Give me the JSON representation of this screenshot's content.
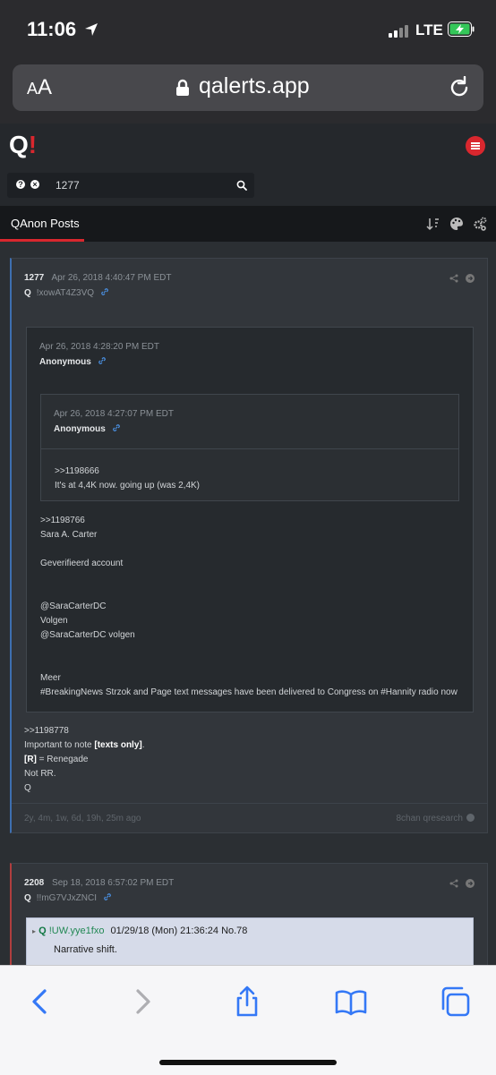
{
  "status": {
    "time": "11:06",
    "network": "LTE"
  },
  "browser": {
    "text_size_label_small": "A",
    "text_size_label_large": "A",
    "domain": "qalerts.app"
  },
  "site": {
    "logo_q": "Q",
    "logo_bang": "!",
    "search": {
      "help": "?",
      "clear": "×",
      "query": "1277"
    },
    "nav_title": "QAnon Posts"
  },
  "posts": [
    {
      "number": "1277",
      "datetime": "Apr 26, 2018 4:40:47 PM EDT",
      "author": "Q",
      "tripcode": "!xowAT4Z3VQ",
      "quote": {
        "datetime": "Apr 26, 2018 4:28:20 PM EDT",
        "author": "Anonymous",
        "inner_quote": {
          "datetime": "Apr 26, 2018 4:27:07 PM EDT",
          "author": "Anonymous",
          "line1": ">>1198666",
          "line2": "It's at 4,4K now. going up (was 2,4K)"
        },
        "line1": ">>1198766",
        "line2": "Sara A. Carter",
        "line3": "Geverifieerd account",
        "line4": "@SaraCarterDC",
        "line5": "Volgen",
        "line6": "@SaraCarterDC volgen",
        "line7": "Meer",
        "line8": "#BreakingNews Strzok and Page text messages have been delivered to Congress on #Hannity radio now"
      },
      "body": {
        "line1": ">>1198778",
        "line2_prefix": "Important to note ",
        "line2_bold": "[texts only]",
        "line2_suffix": ".",
        "line3_bold": "[R]",
        "line3_rest": " = Renegade",
        "line4": "Not RR.",
        "line5": "Q"
      },
      "age": "2y, 4m, 1w, 6d, 19h, 25m ago",
      "source": "8chan qresearch"
    },
    {
      "number": "2208",
      "datetime": "Sep 18, 2018 6:57:02 PM EDT",
      "author": "Q",
      "tripcode": "!!mG7VJxZNCI",
      "embedded": {
        "arrow": "▸",
        "name": "Q",
        "trip": "!UW.yye1fxo",
        "datetime": "01/29/18 (Mon) 21:36:24",
        "number": "No.78",
        "text": "Narrative shift."
      }
    }
  ],
  "colors": {
    "accent_red": "#d9272e",
    "link_blue": "#4a90e2",
    "ios_blue": "#3478f6"
  }
}
